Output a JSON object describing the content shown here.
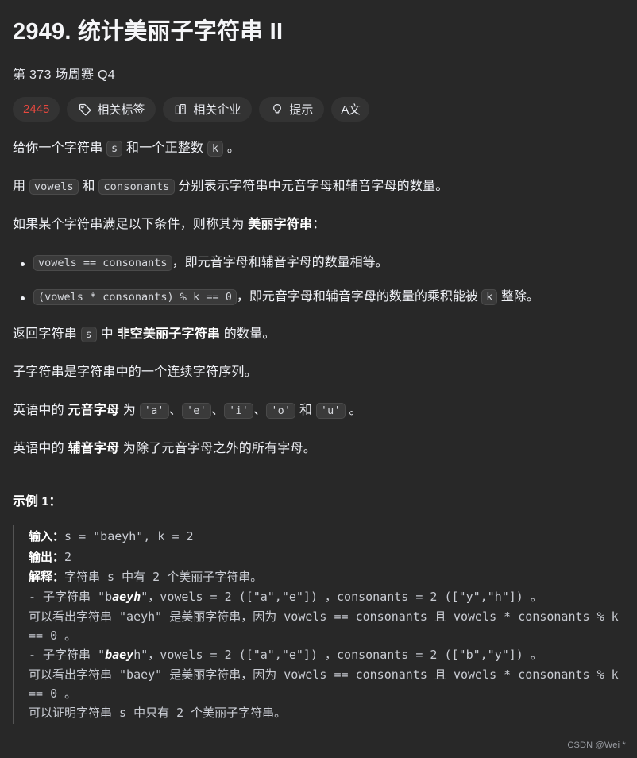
{
  "theme": {
    "background": "#282828",
    "text": "#eff1f6",
    "pill_background": "#333333",
    "accent_red": "#e8483f",
    "code_background": "#3a3a3a",
    "code_border": "#4a4a4a",
    "codeblock_border": "#545454",
    "watermark": "#9a9da3"
  },
  "header": {
    "title": "2949. 统计美丽子字符串 II",
    "subtitle": "第 373 场周赛 Q4"
  },
  "toolbar": {
    "items": [
      {
        "name": "difficulty-count",
        "label": "2445",
        "icon": null
      },
      {
        "name": "related-tags",
        "label": "相关标签",
        "icon": "tag-icon"
      },
      {
        "name": "related-companies",
        "label": "相关企业",
        "icon": "building-icon"
      },
      {
        "name": "hint",
        "label": "提示",
        "icon": "lightbulb-icon"
      },
      {
        "name": "translate",
        "label": "A文",
        "icon": "translate-icon"
      }
    ]
  },
  "description": {
    "p1": {
      "t1": "给你一个字符串 ",
      "c1": "s",
      "t2": " 和一个正整数 ",
      "c2": "k",
      "t3": " 。"
    },
    "p2": {
      "t1": "用 ",
      "c1": "vowels",
      "t2": " 和 ",
      "c2": "consonants",
      "t3": " 分别表示字符串中元音字母和辅音字母的数量。"
    },
    "p3": {
      "t1": "如果某个字符串满足以下条件，则称其为 ",
      "b1": "美丽字符串",
      "t2": "："
    },
    "conditions": [
      {
        "code": "vowels == consonants",
        "text": "，即元音字母和辅音字母的数量相等。"
      },
      {
        "code": "(vowels * consonants) % k == 0",
        "text_a": "，即元音字母和辅音字母的数量的乘积能被 ",
        "code_b": "k",
        "text_b": " 整除。"
      }
    ],
    "p4": {
      "t1": "返回字符串 ",
      "c1": "s",
      "t2": " 中 ",
      "b1": "非空美丽子字符串",
      "t3": " 的数量。"
    },
    "p5": "子字符串是字符串中的一个连续字符序列。",
    "p6": {
      "t1": "英语中的 ",
      "b1": "元音字母",
      "t2": " 为 ",
      "c1": "'a'",
      "t3": "、",
      "c2": "'e'",
      "t4": "、",
      "c3": "'i'",
      "t5": "、",
      "c4": "'o'",
      "t6": " 和 ",
      "c5": "'u'",
      "t7": " 。"
    },
    "p7": {
      "t1": "英语中的 ",
      "b1": "辅音字母",
      "t2": " 为除了元音字母之外的所有字母。"
    }
  },
  "example": {
    "title": "示例 1：",
    "input_label": "输入：",
    "input_value": "s = \"baeyh\", k = 2",
    "output_label": "输出：",
    "output_value": "2",
    "explain_label": "解释：",
    "explain_value": "字符串 s 中有 2 个美丽子字符串。",
    "lines": [
      {
        "pre": "- 子字符串 \"b",
        "hl": "aeyh",
        "post": "\"，vowels = 2 ([\"a\",\"e\"]) ，consonants = 2 ([\"y\",\"h\"]) 。"
      },
      {
        "plain": "可以看出字符串 \"aeyh\" 是美丽字符串，因为 vowels == consonants 且 vowels * consonants % k == 0 。"
      },
      {
        "pre": "- 子字符串 \"",
        "hl": "baey",
        "post": "h\"，vowels = 2 ([\"a\",\"e\"]) ，consonants = 2 ([\"b\",\"y\"]) 。"
      },
      {
        "plain": "可以看出字符串 \"baey\" 是美丽字符串，因为 vowels == consonants 且 vowels * consonants % k == 0 。"
      },
      {
        "plain": "可以证明字符串 s 中只有 2 个美丽子字符串。"
      }
    ]
  },
  "watermark": "CSDN @Wei *"
}
